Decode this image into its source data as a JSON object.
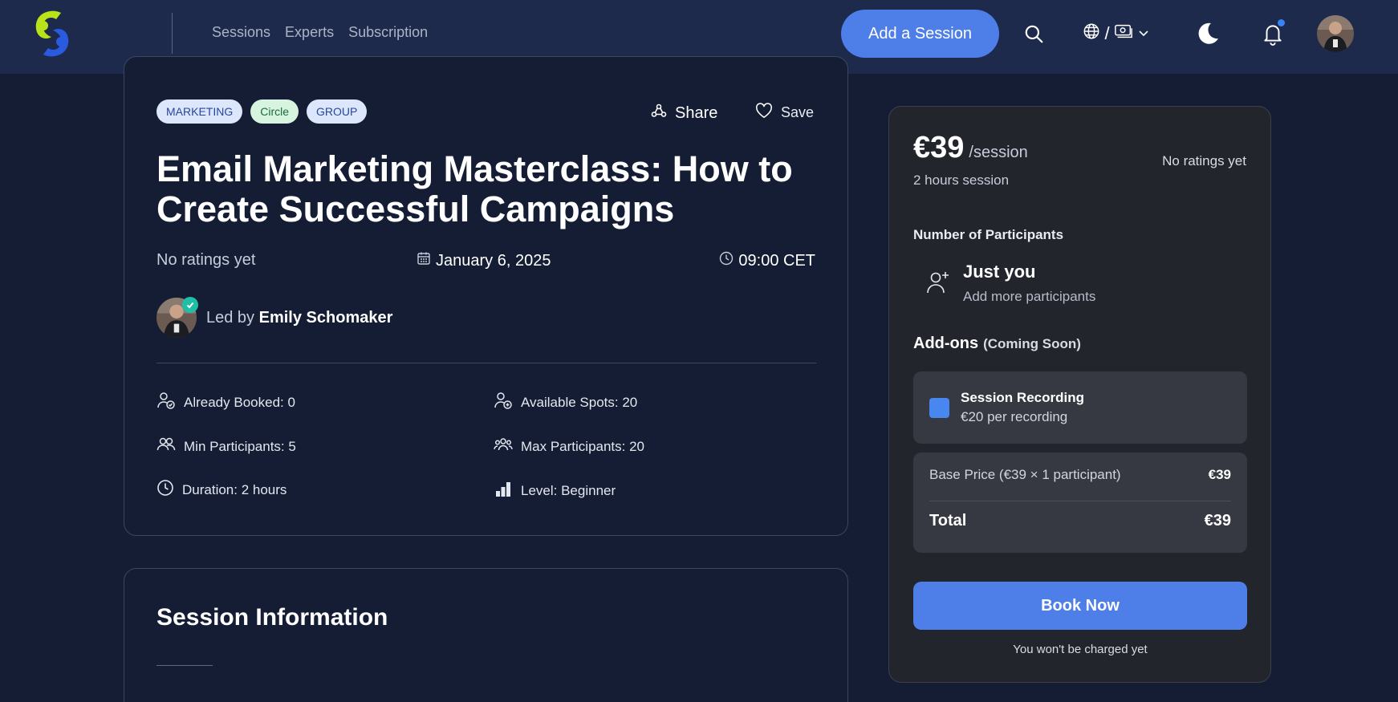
{
  "nav": {
    "links": [
      "Sessions",
      "Experts",
      "Subscription"
    ],
    "add_session_label": "Add a Session",
    "lang_separator": "/"
  },
  "session": {
    "tags": [
      "MARKETING",
      "Circle",
      "GROUP"
    ],
    "share_label": "Share",
    "save_label": "Save",
    "title": "Email Marketing Masterclass: How to Create Successful Campaigns",
    "ratings": "No ratings yet",
    "date": "January 6, 2025",
    "time": "09:00 CET",
    "led_by_prefix": "Led by",
    "leader_name": "Emily Schomaker",
    "stats": {
      "already_booked": "Already Booked: 0",
      "available_spots": "Available Spots: 20",
      "min_participants": "Min Participants: 5",
      "max_participants": "Max Participants: 20",
      "duration": "Duration: 2 hours",
      "level": "Level: Beginner"
    }
  },
  "info": {
    "title": "Session Information"
  },
  "booking": {
    "price": "€39",
    "price_unit": "/session",
    "ratings": "No ratings yet",
    "session_length": "2 hours session",
    "participants_label": "Number of Participants",
    "participants_main": "Just you",
    "participants_sub": "Add more participants",
    "addons_label": "Add-ons",
    "addons_coming_soon": "(Coming Soon)",
    "addon_name": "Session Recording",
    "addon_price": "€20 per recording",
    "base_price_label": "Base Price (€39 × 1 participant)",
    "base_price_value": "€39",
    "total_label": "Total",
    "total_value": "€39",
    "book_label": "Book Now",
    "no_charge_text": "You won't be charged yet"
  },
  "colors": {
    "accent": "#4e7fe8",
    "navbar_bg": "#1e2a4c",
    "page_bg": "#141d33",
    "booking_bg": "#23252d",
    "verified": "#1fbfa7",
    "notification_dot": "#3b82f6"
  },
  "icons": [
    "logo",
    "search-icon",
    "globe-icon",
    "currency-icon",
    "chevron-down-icon",
    "moon-icon",
    "bell-icon",
    "share-icon",
    "heart-icon",
    "calendar-icon",
    "clock-icon",
    "check-icon",
    "user-plus-icon"
  ]
}
